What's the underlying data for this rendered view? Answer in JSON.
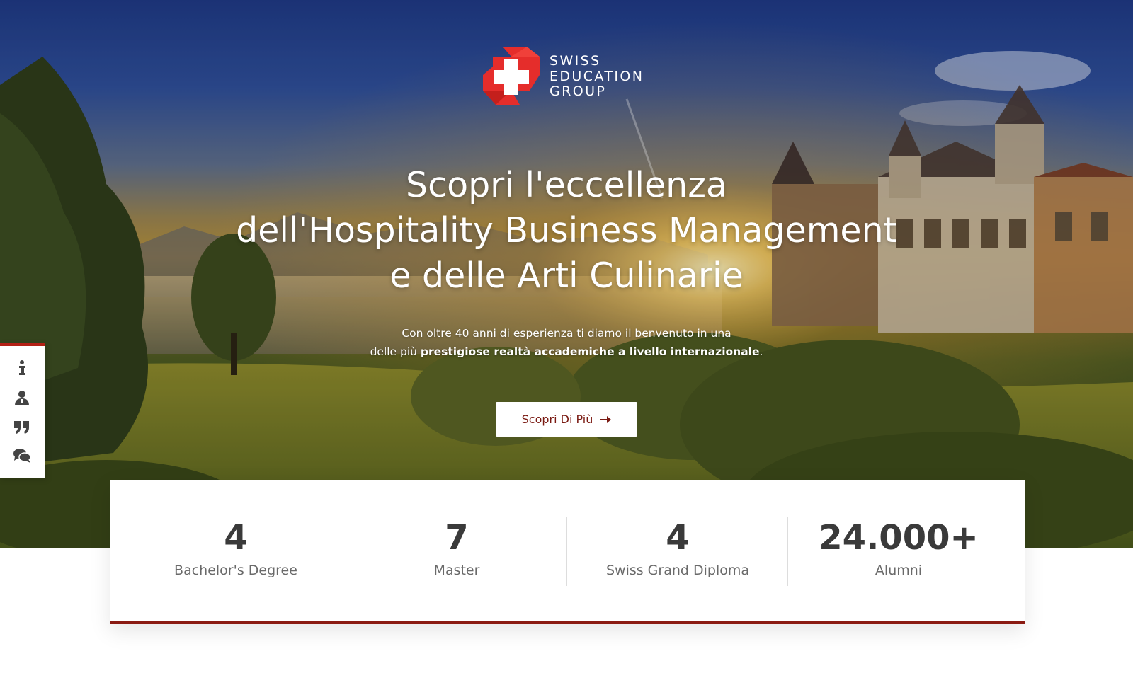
{
  "brand": {
    "name_lines": [
      "SWISS",
      "EDUCATION",
      "GROUP"
    ],
    "colors": {
      "red": "#e52d2b",
      "dark_red": "#8a1a12",
      "white": "#ffffff"
    }
  },
  "hero": {
    "headline_lines": [
      "Scopri l'eccellenza",
      "dell'Hospitality Business Management",
      "e delle Arti Culinarie"
    ],
    "subtext_line1": "Con oltre 40 anni di esperienza ti diamo il benvenuto in una",
    "subtext_line2_prefix": "delle più ",
    "subtext_line2_bold": "prestigiose realtà accademiche a livello internazionale",
    "subtext_line2_suffix": ".",
    "cta_label": "Scopri Di Più",
    "cta_icon": "arrow-right-icon"
  },
  "sidebar": {
    "items": [
      {
        "icon": "info-icon"
      },
      {
        "icon": "user-icon"
      },
      {
        "icon": "quote-icon"
      },
      {
        "icon": "chat-icon"
      }
    ]
  },
  "stats": [
    {
      "value": "4",
      "label": "Bachelor's Degree"
    },
    {
      "value": "7",
      "label": "Master"
    },
    {
      "value": "4",
      "label": "Swiss Grand Diploma"
    },
    {
      "value": "24.000+",
      "label": "Alumni"
    }
  ]
}
